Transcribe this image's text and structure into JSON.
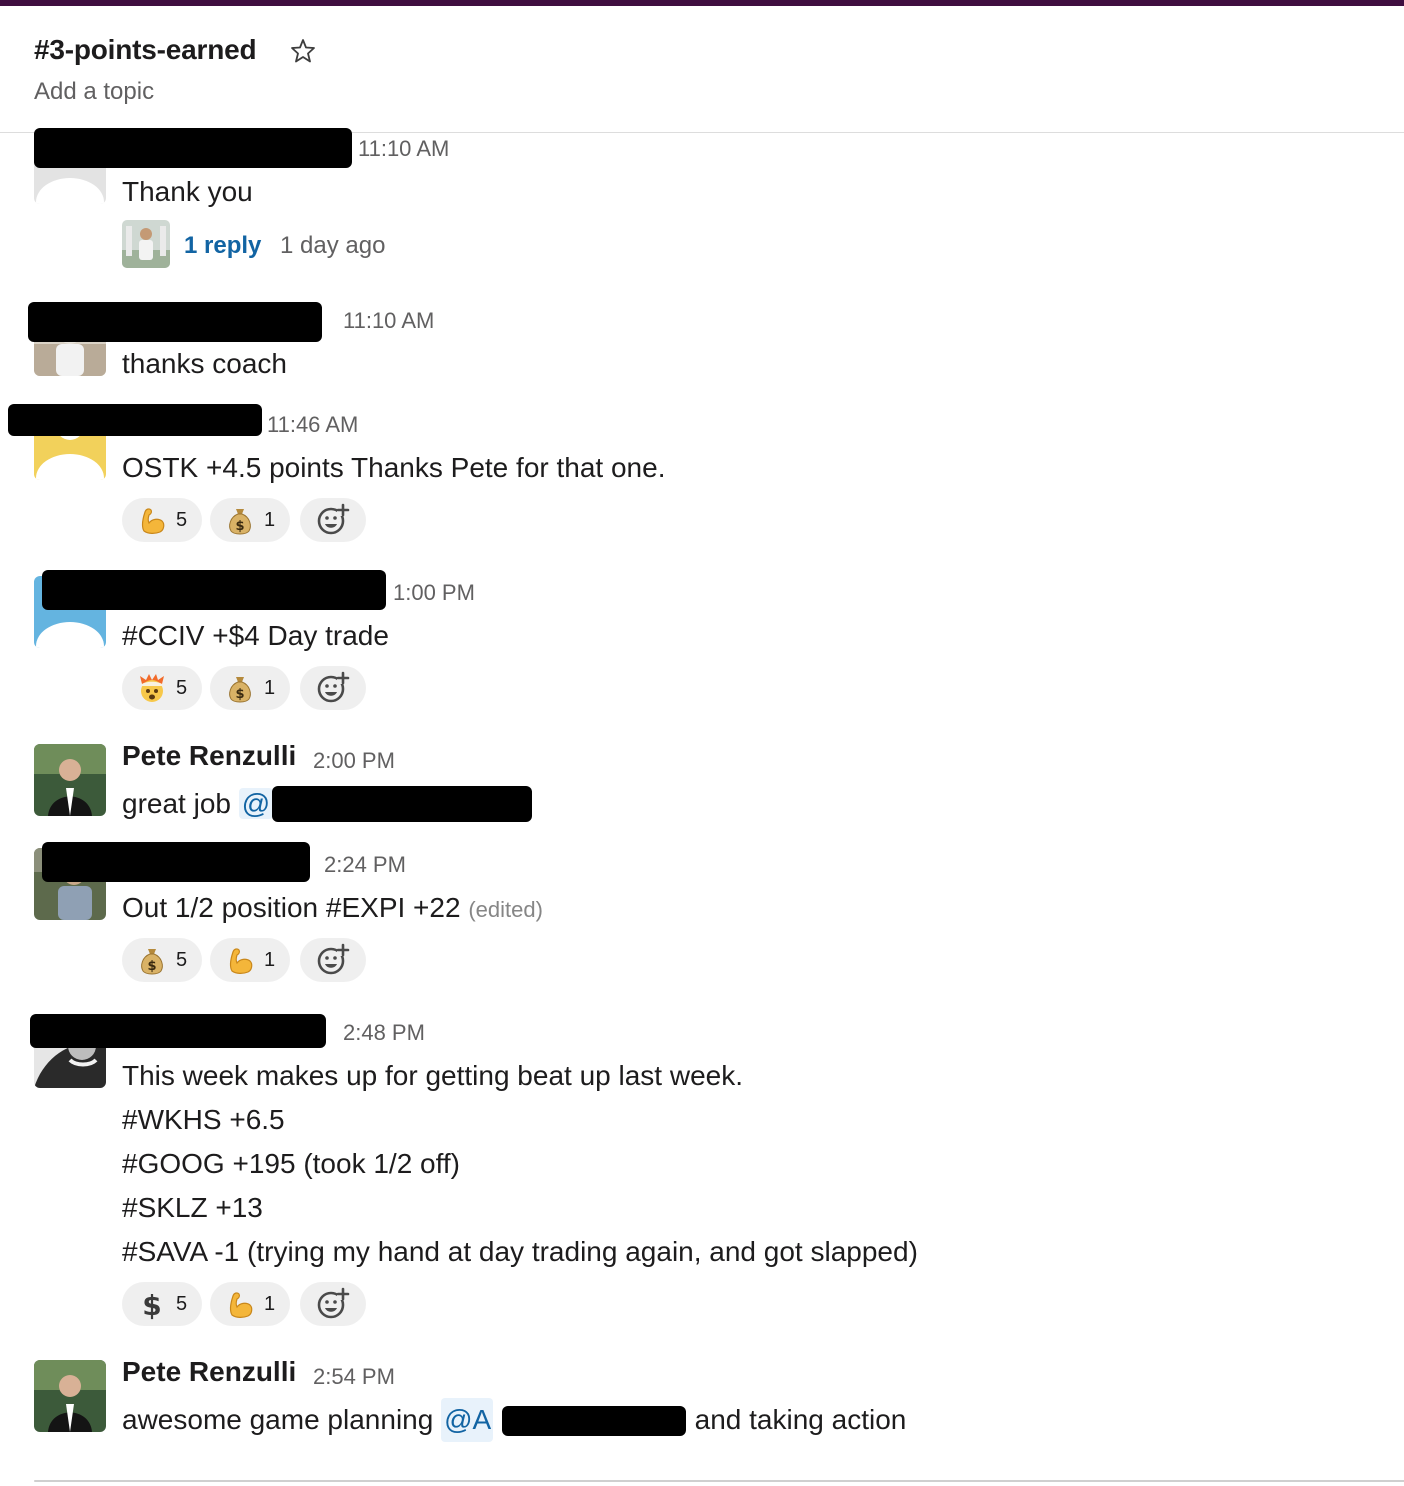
{
  "channel": {
    "name": "#3-points-earned",
    "topic": "Add a topic"
  },
  "messages": [
    {
      "time": "11:10 AM",
      "text": "Thank you",
      "thread": {
        "reply_count": "1 reply",
        "last_reply": "1 day ago"
      }
    },
    {
      "time": "11:10 AM",
      "text": "thanks coach"
    },
    {
      "time": "11:46 AM",
      "text": "OSTK +4.5 points Thanks Pete for that one.",
      "reactions": [
        {
          "icon": "flexed-biceps-icon",
          "count": "5"
        },
        {
          "icon": "money-bag-icon",
          "count": "1"
        }
      ]
    },
    {
      "time": "1:00 PM",
      "text": "#CCIV +$4 Day trade",
      "reactions": [
        {
          "icon": "exploding-head-icon",
          "count": "5"
        },
        {
          "icon": "money-bag-icon",
          "count": "1"
        }
      ]
    },
    {
      "author": "Pete Renzulli",
      "time": "2:00 PM",
      "text": "great job",
      "mention": "@"
    },
    {
      "time": "2:24 PM",
      "text": "Out 1/2 position #EXPI +22",
      "edited": "(edited)",
      "reactions": [
        {
          "icon": "money-bag-icon",
          "count": "5"
        },
        {
          "icon": "flexed-biceps-icon",
          "count": "1"
        }
      ]
    },
    {
      "time": "2:48 PM",
      "lines": [
        "This week makes up for getting beat up last week.",
        "#WKHS +6.5",
        "#GOOG +195 (took 1/2 off)",
        "#SKLZ +13",
        "#SAVA -1 (trying my hand at day trading again, and got slapped)"
      ],
      "reactions": [
        {
          "icon": "heavy-dollar-sign-icon",
          "count": "5"
        },
        {
          "icon": "flexed-biceps-icon",
          "count": "1"
        }
      ]
    },
    {
      "author": "Pete Renzulli",
      "time": "2:54 PM",
      "text_before": "awesome game planning",
      "mention": "@A",
      "text_after": "and taking action"
    }
  ],
  "colors": {
    "workspace_bar": "#3f0e40",
    "link": "#1264a3",
    "mention_bg": "#e8f2fb",
    "reaction_bg": "#efefef",
    "muted_text": "#616061"
  }
}
